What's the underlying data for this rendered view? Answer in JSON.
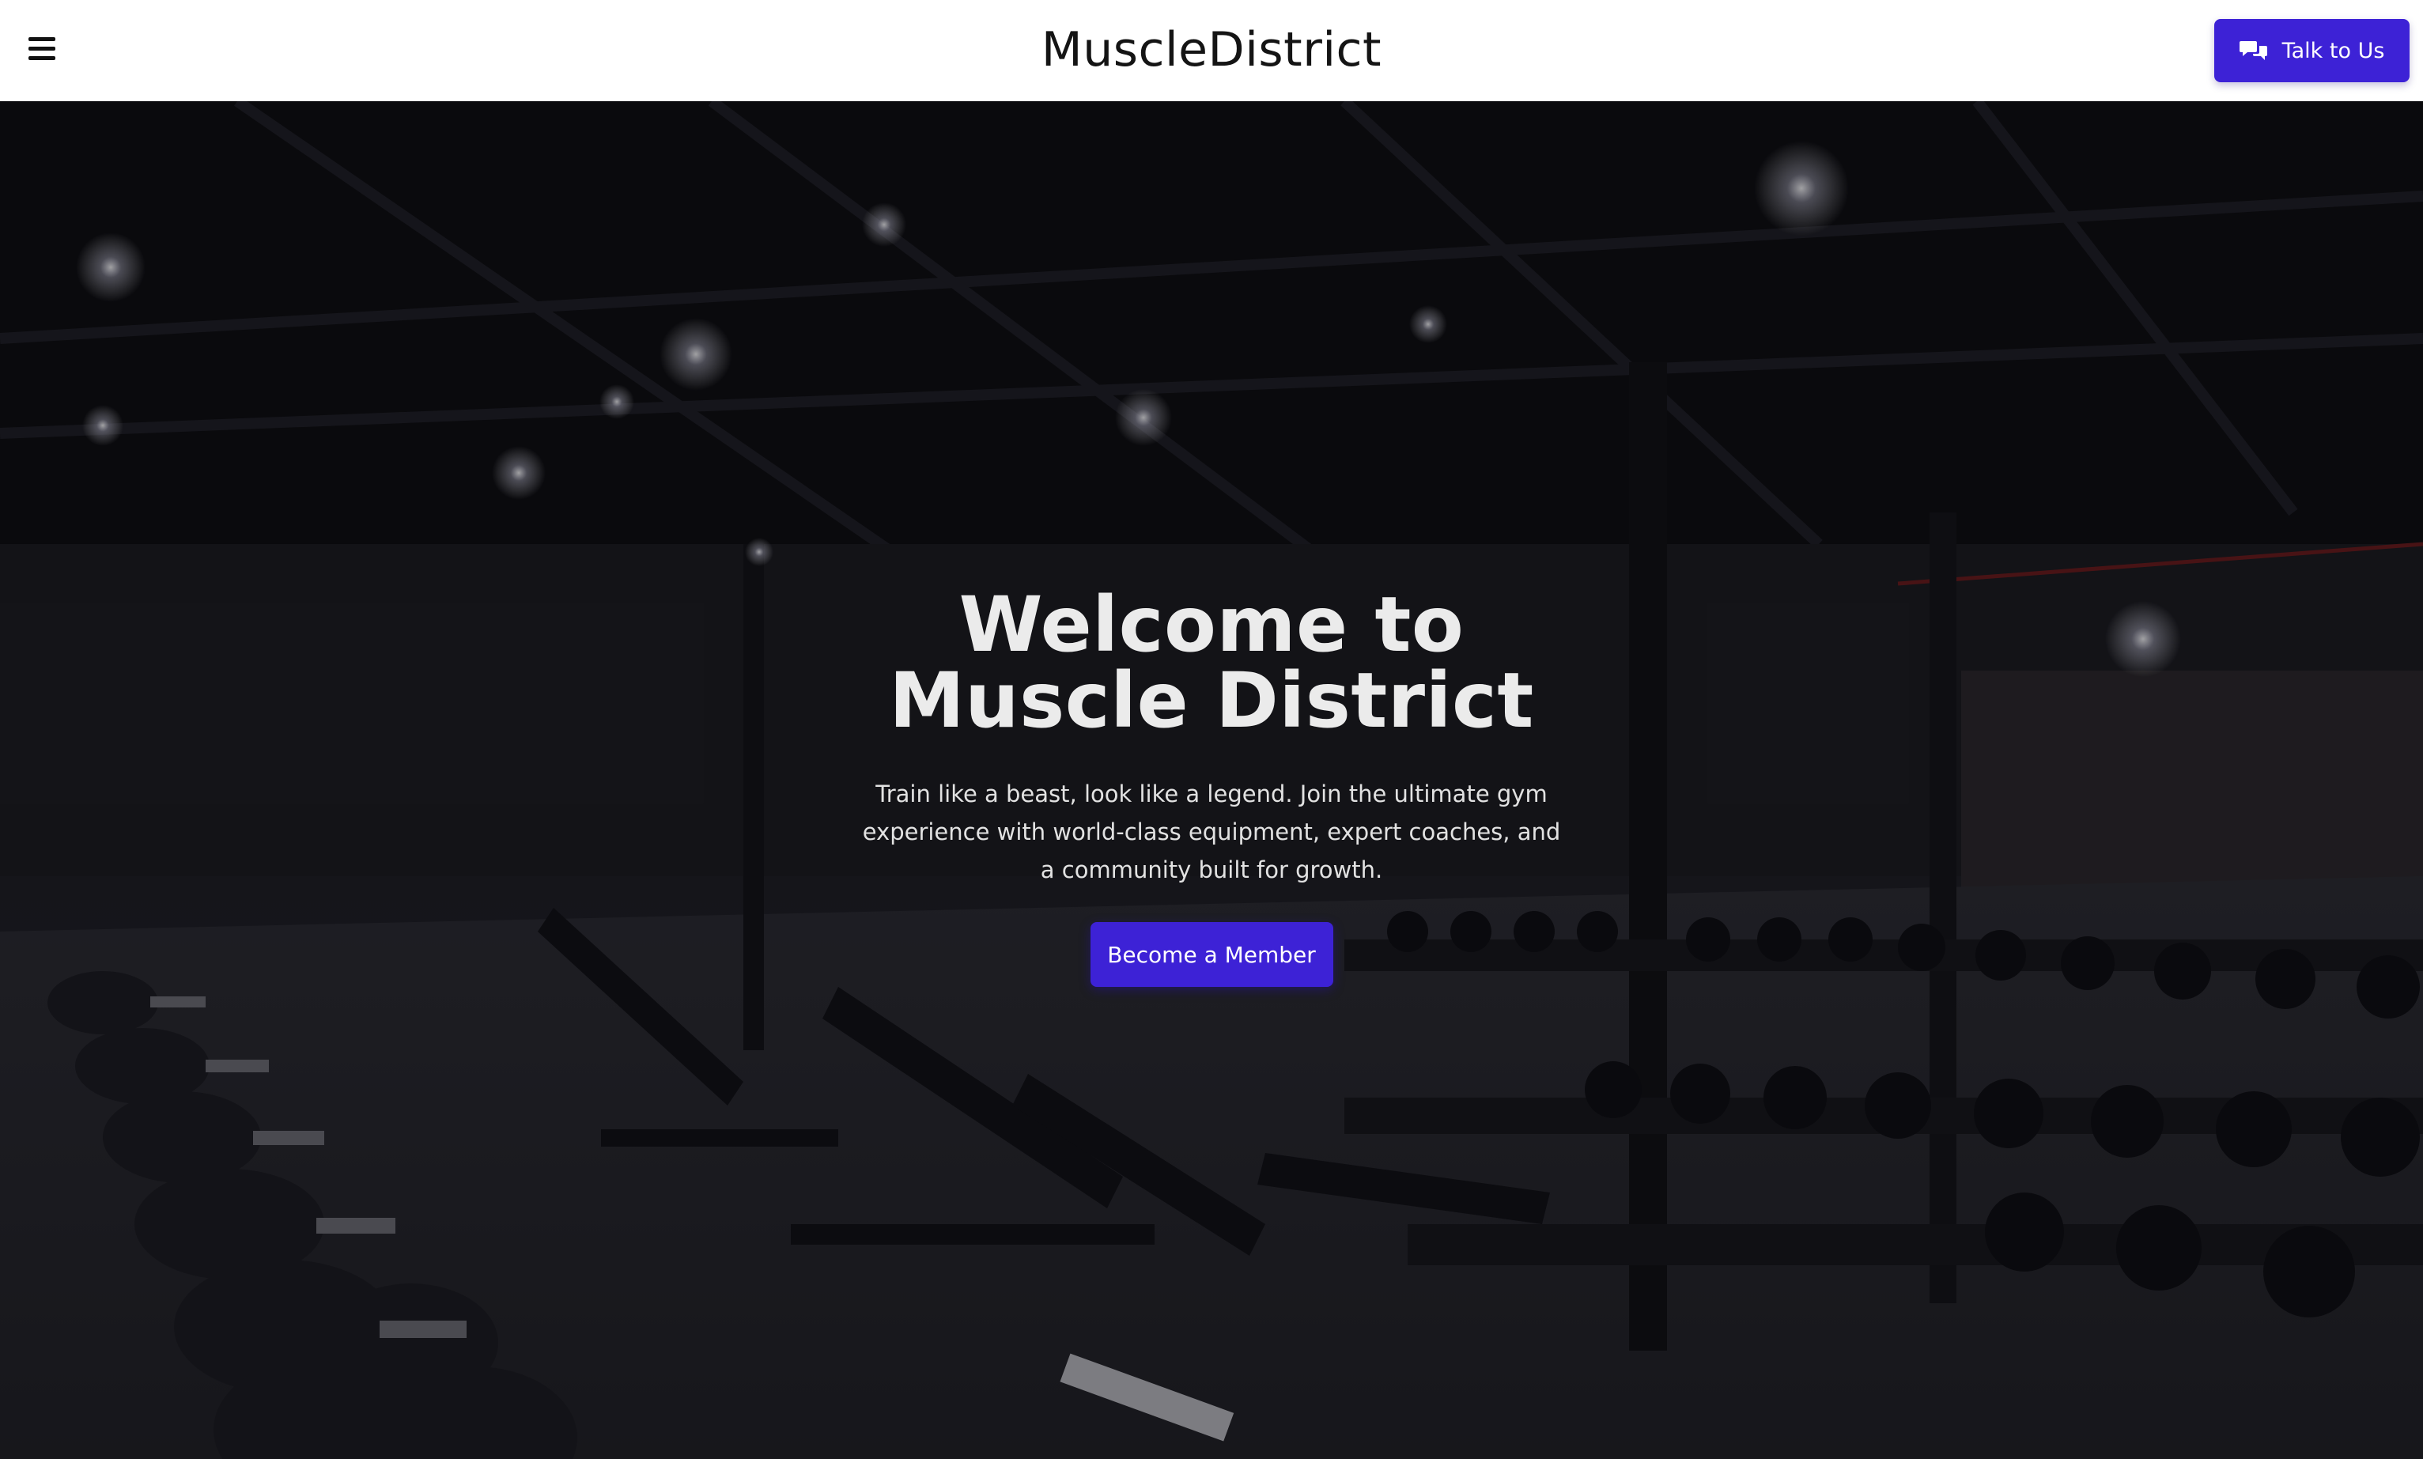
{
  "header": {
    "menu_icon": "hamburger-menu-icon",
    "brand": "MuscleDistrict",
    "talk_button": {
      "label": "Talk to Us",
      "icon": "chat-bubbles-icon"
    }
  },
  "hero": {
    "title": "Welcome to Muscle District",
    "description": "Train like a beast, look like a legend. Join the ultimate gym experience with world-class equipment, expert coaches, and a community built for growth.",
    "cta_label": "Become a Member",
    "background": "dark gym interior with benches and dumbbell racks"
  },
  "colors": {
    "accent": "#3d22d6",
    "header_bg": "#ffffff",
    "hero_text": "#ebebeb"
  }
}
